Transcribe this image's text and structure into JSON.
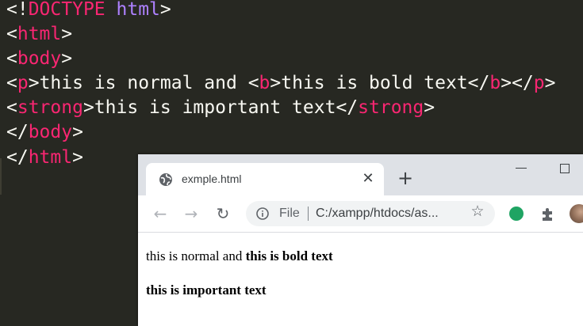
{
  "editor": {
    "lines": [
      {
        "p1": "<!",
        "p2": "DOCTYPE",
        "p3": " ",
        "p4": "html",
        "p5": ">"
      },
      {
        "a": "<",
        "b": "html",
        "c": ">"
      },
      {
        "a": "<",
        "b": "body",
        "c": ">"
      },
      {
        "o1": "<",
        "t1": "p",
        "c1": ">",
        "text1": "this is normal and ",
        "o2": "<",
        "t2": "b",
        "c2": ">",
        "text2": "this is bold text",
        "o3": "</",
        "t3": "b",
        "c3": "></",
        "t4": "p",
        "c4": ">"
      },
      {
        "o1": "<",
        "t1": "strong",
        "c1": ">",
        "text1": "this is important text",
        "o2": "</",
        "t2": "strong",
        "c2": ">"
      },
      {
        "a": "</",
        "b": "body",
        "c": ">"
      },
      {
        "a": "</",
        "b": "html",
        "c": ">"
      }
    ]
  },
  "browser": {
    "tab": {
      "title": "exmple.html",
      "close": "✕"
    },
    "new_tab": "+",
    "toolbar": {
      "back": "←",
      "forward": "→",
      "reload": "↻",
      "scheme": "File",
      "url": "C:/xampp/htdocs/as...",
      "star": "☆"
    },
    "icons": [
      "globe-icon",
      "info-icon",
      "star-icon",
      "extension-green-icon",
      "puzzle-icon",
      "avatar"
    ],
    "page": {
      "normal_text": "this is normal and ",
      "bold_text": "this is bold text",
      "strong_text": "this is important text"
    }
  },
  "colors": {
    "editor_bg": "#272822",
    "tag": "#f92672",
    "keyword": "#ae81ff",
    "text": "#f8f8f2",
    "tabstrip": "#dee1e6"
  }
}
